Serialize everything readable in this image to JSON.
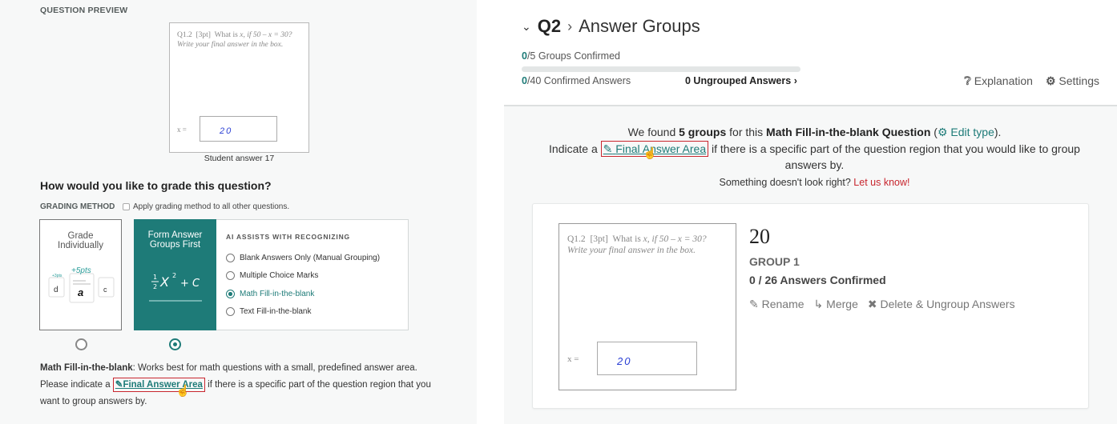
{
  "left": {
    "section_label": "QUESTION PREVIEW",
    "question": {
      "number": "Q1.2",
      "points": "[3pt]",
      "prompt_prefix": "What is",
      "prompt_math": "x, if 50 – x = 30?",
      "instruction": "Write your final answer in the box.",
      "answer_label": "x =",
      "student_answer": "20"
    },
    "caption": "Student answer 17",
    "grade_heading": "How would you like to grade this question?",
    "grading_method_label": "GRADING METHOD",
    "apply_all_label": "Apply grading method to all other questions.",
    "apply_all_checked": false,
    "methods": [
      {
        "label": "Grade Individually",
        "selected": false,
        "art": {
          "small_left": "+3pts",
          "big": "+5pts",
          "letters": [
            "d",
            "a",
            "c"
          ]
        }
      },
      {
        "label": "Form Answer Groups First",
        "selected": true,
        "art": {
          "formula_frac_num": "1",
          "formula_frac_den": "2",
          "formula_rest": "X",
          "exp": "2",
          "tail": "+ C"
        }
      }
    ],
    "ai_heading": "AI ASSISTS WITH RECOGNIZING",
    "ai_options": [
      {
        "label": "Blank Answers Only (Manual Grouping)",
        "selected": false
      },
      {
        "label": "Multiple Choice Marks",
        "selected": false
      },
      {
        "label": "Math Fill-in-the-blank",
        "selected": true
      },
      {
        "label": "Text Fill-in-the-blank",
        "selected": false
      }
    ],
    "description": {
      "bold": "Math Fill-in-the-blank",
      "part1": ": Works best for math questions with a small, predefined answer area. Please indicate a ",
      "link": "Final Answer Area",
      "part2": " if there is a specific part of the question region that you want to group answers by."
    }
  },
  "right": {
    "question": "Q2",
    "page_title": "Answer Groups",
    "groups_confirmed": "0",
    "groups_total": "/5 Groups Confirmed",
    "groups_progress": 0,
    "answers_confirmed": "0",
    "answers_total": "/40 Confirmed Answers",
    "ungrouped": "0 Ungrouped Answers",
    "explanation": "Explanation",
    "settings": "Settings",
    "found": {
      "t1": "We found ",
      "groups": "5 groups",
      "t2": " for this ",
      "qtype": "Math Fill-in-the-blank Question",
      "t3": " (",
      "edit": "Edit type",
      "t4": ").",
      "t5": "Indicate a ",
      "link": "Final Answer Area",
      "t6": " if there is a specific part of the question region that you would like to group answers by.",
      "t7": "Something doesn't look right? ",
      "letus": "Let us know!"
    },
    "group": {
      "value": "20",
      "name": "GROUP 1",
      "confirmed": "0 / 26 Answers Confirmed",
      "actions": {
        "rename": "Rename",
        "merge": "Merge",
        "delete": "Delete & Ungroup Answers"
      }
    }
  }
}
